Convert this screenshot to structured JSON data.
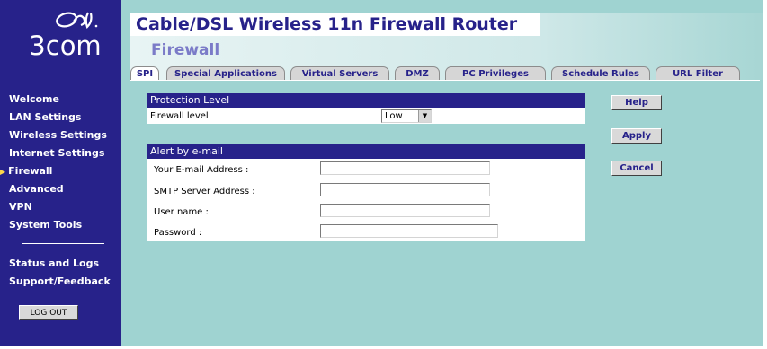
{
  "brand": {
    "logo_text": "3com",
    "logo_mark": "3com-swirl-logo"
  },
  "header": {
    "title": "Cable/DSL Wireless 11n Firewall Router",
    "section": "Firewall"
  },
  "tabs": [
    {
      "label": "SPI",
      "active": true
    },
    {
      "label": "Special Applications",
      "active": false
    },
    {
      "label": "Virtual Servers",
      "active": false
    },
    {
      "label": "DMZ",
      "active": false
    },
    {
      "label": "PC Privileges",
      "active": false
    },
    {
      "label": "Schedule Rules",
      "active": false
    },
    {
      "label": "URL Filter",
      "active": false
    }
  ],
  "sidebar": {
    "items": [
      {
        "label": "Welcome"
      },
      {
        "label": "LAN Settings"
      },
      {
        "label": "Wireless Settings"
      },
      {
        "label": "Internet Settings"
      },
      {
        "label": "Firewall",
        "active": true
      },
      {
        "label": "Advanced"
      },
      {
        "label": "VPN"
      },
      {
        "label": "System Tools"
      },
      {
        "label": "Status and Logs"
      },
      {
        "label": "Support/Feedback"
      }
    ],
    "logout_label": "LOG OUT",
    "active_marker": "▶"
  },
  "protection": {
    "heading": "Protection Level",
    "firewall_level_label": "Firewall level",
    "firewall_level_value": "Low"
  },
  "alert": {
    "heading": "Alert by e-mail",
    "email_label": "Your E-mail Address :",
    "email_value": "",
    "smtp_label": "SMTP Server Address :",
    "smtp_value": "",
    "username_label": "User name :",
    "username_value": "",
    "password_label": "Password :",
    "password_value": ""
  },
  "buttons": {
    "help": "Help",
    "apply": "Apply",
    "cancel": "Cancel"
  },
  "colors": {
    "sidebar": "#27228a",
    "content_bg": "#9fd3d1",
    "accent_text": "#27228a",
    "section_title": "#7b7bc8"
  }
}
